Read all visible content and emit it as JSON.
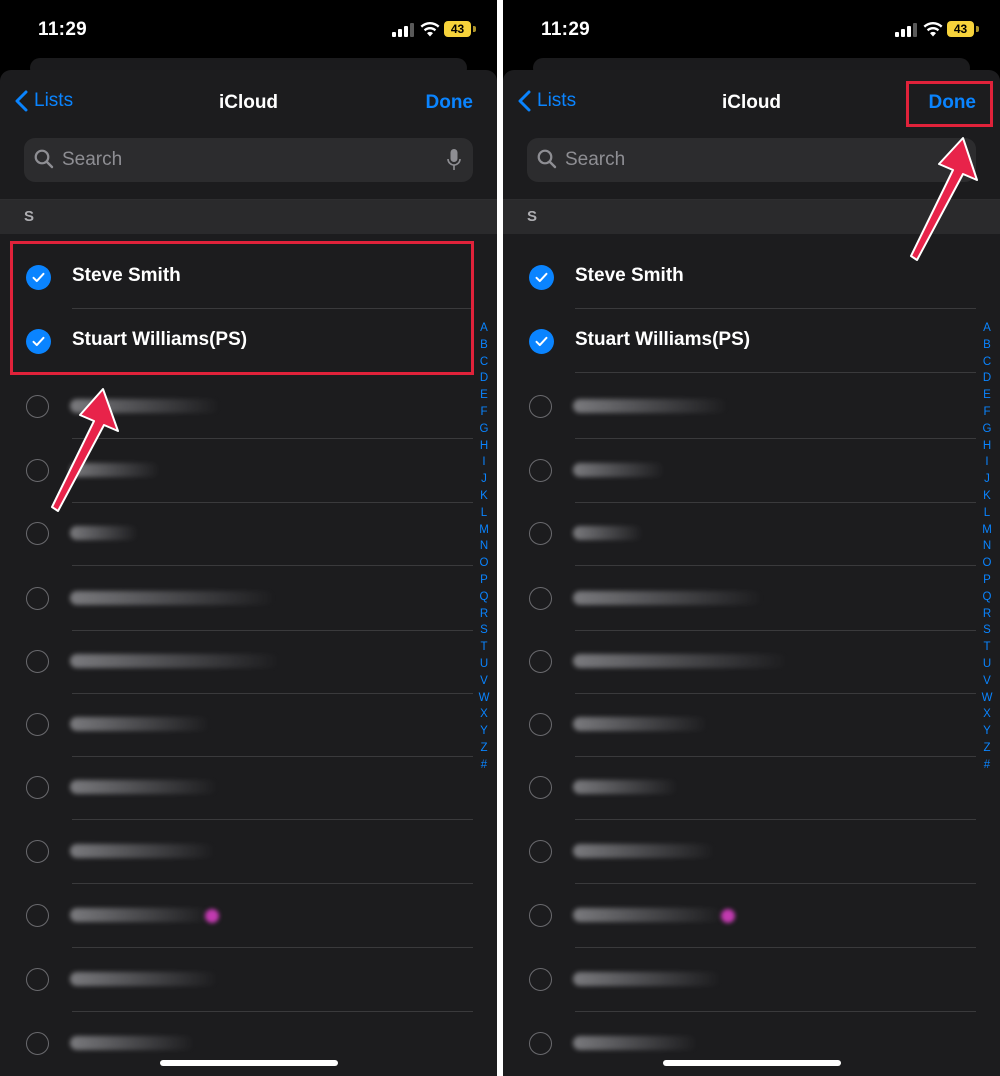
{
  "status": {
    "time": "11:29",
    "battery": "43"
  },
  "nav": {
    "back_label": "Lists",
    "title": "iCloud",
    "done_label": "Done"
  },
  "search": {
    "placeholder": "Search"
  },
  "section_header": "S",
  "contacts": [
    {
      "name": "Steve Smith",
      "selected": true
    },
    {
      "name": "Stuart Williams(PS)",
      "selected": true
    }
  ],
  "index_letters": [
    "A",
    "B",
    "C",
    "D",
    "E",
    "F",
    "G",
    "H",
    "I",
    "J",
    "K",
    "L",
    "M",
    "N",
    "O",
    "P",
    "Q",
    "R",
    "S",
    "T",
    "U",
    "V",
    "W",
    "X",
    "Y",
    "Z",
    "#"
  ],
  "colors": {
    "accent": "#0a84ff",
    "highlight": "#e0223a",
    "sheet_bg": "#1c1c1e"
  }
}
